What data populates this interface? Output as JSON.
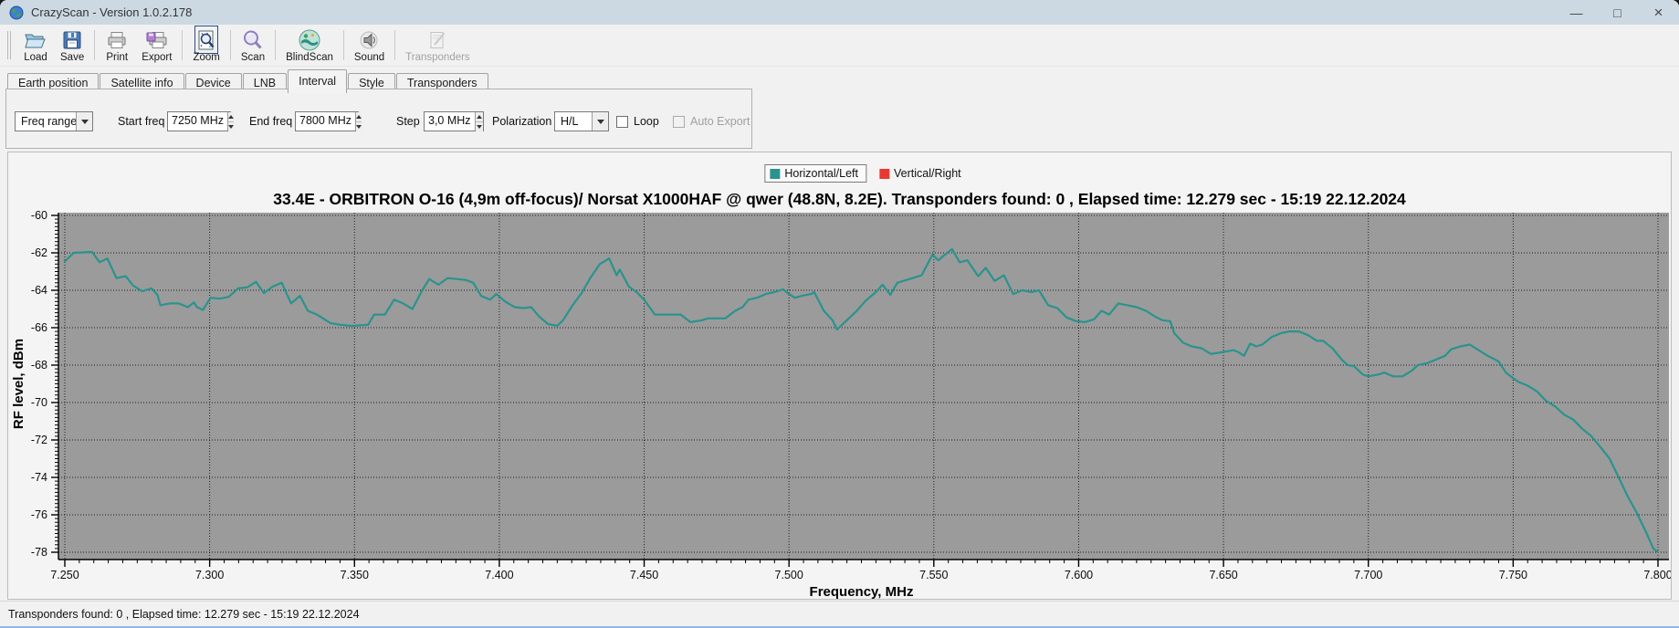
{
  "window": {
    "title": "CrazyScan - Version 1.0.2.178",
    "controls": {
      "minimize": "—",
      "maximize": "□",
      "close": "×"
    }
  },
  "toolbar": {
    "buttons": [
      {
        "label": "Load",
        "icon": "open-folder-icon",
        "enabled": true
      },
      {
        "label": "Save",
        "icon": "floppy-disk-icon",
        "enabled": true
      },
      {
        "label": "Print",
        "icon": "printer-icon",
        "enabled": true
      },
      {
        "label": "Export",
        "icon": "export-printer-icon",
        "enabled": true
      },
      {
        "label": "Zoom",
        "icon": "zoom-document-icon",
        "enabled": true
      },
      {
        "label": "Scan",
        "icon": "magnifier-icon",
        "enabled": true
      },
      {
        "label": "BlindScan",
        "icon": "blindscan-globe-icon",
        "enabled": true
      },
      {
        "label": "Sound",
        "icon": "speaker-icon",
        "enabled": true
      },
      {
        "label": "Transponders",
        "icon": "transponder-list-icon",
        "enabled": false
      }
    ]
  },
  "tabs": {
    "items": [
      {
        "label": "Earth position"
      },
      {
        "label": "Satellite info"
      },
      {
        "label": "Device"
      },
      {
        "label": "LNB"
      },
      {
        "label": "Interval",
        "active": true
      },
      {
        "label": "Style"
      },
      {
        "label": "Transponders"
      }
    ]
  },
  "interval_panel": {
    "freq_range": {
      "value": "Freq range"
    },
    "start_freq": {
      "label": "Start freq",
      "value": "7250 MHz"
    },
    "end_freq": {
      "label": "End freq",
      "value": "7800 MHz"
    },
    "step": {
      "label": "Step",
      "value": "3,0 MHz"
    },
    "polarization": {
      "label": "Polarization",
      "value": "H/L"
    },
    "loop": {
      "label": "Loop",
      "checked": false
    },
    "auto_export": {
      "label": "Auto Export",
      "checked": false,
      "enabled": false
    }
  },
  "statusbar": {
    "text": "Transponders found: 0 , Elapsed time: 12.279 sec - 15:19 22.12.2024"
  },
  "chart_data": {
    "type": "line",
    "title": "33.4E - ORBITRON O-16 (4,9m off-focus)/ Norsat X1000HAF @ qwer (48.8N, 8.2E). Transponders found: 0 , Elapsed time: 12.279 sec - 15:19 22.12.2024",
    "xlabel": "Frequency, MHz",
    "ylabel": "RF level, dBm",
    "xlim": [
      7.25,
      7.8
    ],
    "ylim": [
      -78,
      -60
    ],
    "grid": true,
    "plot_bg": "#9b9b9b",
    "x_minor_step": 0.005,
    "y_minor_step": 0.2,
    "x_ticks": [
      {
        "v": 7.25,
        "label": "7.250"
      },
      {
        "v": 7.3,
        "label": "7.300"
      },
      {
        "v": 7.35,
        "label": "7.350"
      },
      {
        "v": 7.4,
        "label": "7.400"
      },
      {
        "v": 7.45,
        "label": "7.450"
      },
      {
        "v": 7.5,
        "label": "7.500"
      },
      {
        "v": 7.55,
        "label": "7.550"
      },
      {
        "v": 7.6,
        "label": "7.600"
      },
      {
        "v": 7.65,
        "label": "7.650"
      },
      {
        "v": 7.7,
        "label": "7.700"
      },
      {
        "v": 7.75,
        "label": "7.750"
      },
      {
        "v": 7.8,
        "label": "7.800"
      }
    ],
    "y_ticks": [
      {
        "v": -60,
        "label": "-60"
      },
      {
        "v": -62,
        "label": "-62"
      },
      {
        "v": -64,
        "label": "-64"
      },
      {
        "v": -66,
        "label": "-66"
      },
      {
        "v": -68,
        "label": "-68"
      },
      {
        "v": -70,
        "label": "-70"
      },
      {
        "v": -72,
        "label": "-72"
      },
      {
        "v": -74,
        "label": "-74"
      },
      {
        "v": -76,
        "label": "-76"
      },
      {
        "v": -78,
        "label": "-78"
      }
    ],
    "legend": [
      {
        "name": "Horizontal/Left",
        "color": "#2a938d",
        "selected": true
      },
      {
        "name": "Vertical/Right",
        "color": "#e8382f",
        "selected": false
      }
    ],
    "legend_position": "top-center",
    "series": [
      {
        "name": "Horizontal/Left",
        "color": "#2a938d",
        "points": [
          [
            7.25,
            -62.45
          ],
          [
            7.2531,
            -62.0
          ],
          [
            7.2594,
            -61.95
          ],
          [
            7.262,
            -62.5
          ],
          [
            7.2647,
            -62.3
          ],
          [
            7.2678,
            -63.35
          ],
          [
            7.271,
            -63.25
          ],
          [
            7.2736,
            -63.75
          ],
          [
            7.2767,
            -64.05
          ],
          [
            7.2799,
            -63.9
          ],
          [
            7.282,
            -64.25
          ],
          [
            7.283,
            -64.8
          ],
          [
            7.2862,
            -64.7
          ],
          [
            7.2893,
            -64.7
          ],
          [
            7.2925,
            -64.9
          ],
          [
            7.2946,
            -64.65
          ],
          [
            7.2956,
            -64.9
          ],
          [
            7.2977,
            -65.05
          ],
          [
            7.3003,
            -64.4
          ],
          [
            7.3035,
            -64.45
          ],
          [
            7.3066,
            -64.35
          ],
          [
            7.3098,
            -63.9
          ],
          [
            7.3129,
            -63.85
          ],
          [
            7.316,
            -63.55
          ],
          [
            7.3187,
            -64.15
          ],
          [
            7.3218,
            -63.8
          ],
          [
            7.3249,
            -63.6
          ],
          [
            7.3281,
            -64.7
          ],
          [
            7.3312,
            -64.3
          ],
          [
            7.3339,
            -65.1
          ],
          [
            7.337,
            -65.3
          ],
          [
            7.3417,
            -65.75
          ],
          [
            7.3453,
            -65.85
          ],
          [
            7.349,
            -65.9
          ],
          [
            7.3547,
            -65.85
          ],
          [
            7.3568,
            -65.3
          ],
          [
            7.3605,
            -65.3
          ],
          [
            7.3637,
            -64.5
          ],
          [
            7.3668,
            -64.7
          ],
          [
            7.37,
            -65.0
          ],
          [
            7.3732,
            -64.05
          ],
          [
            7.3758,
            -63.4
          ],
          [
            7.379,
            -63.7
          ],
          [
            7.3821,
            -63.35
          ],
          [
            7.3853,
            -63.4
          ],
          [
            7.3884,
            -63.45
          ],
          [
            7.391,
            -63.6
          ],
          [
            7.3937,
            -64.3
          ],
          [
            7.3968,
            -64.5
          ],
          [
            7.399,
            -64.2
          ],
          [
            7.402,
            -64.6
          ],
          [
            7.4053,
            -64.9
          ],
          [
            7.4084,
            -64.95
          ],
          [
            7.411,
            -64.9
          ],
          [
            7.4137,
            -65.4
          ],
          [
            7.4168,
            -65.8
          ],
          [
            7.42,
            -65.9
          ],
          [
            7.422,
            -65.6
          ],
          [
            7.4253,
            -64.8
          ],
          [
            7.4284,
            -64.15
          ],
          [
            7.4316,
            -63.3
          ],
          [
            7.4347,
            -62.6
          ],
          [
            7.4379,
            -62.3
          ],
          [
            7.4405,
            -63.2
          ],
          [
            7.4416,
            -62.9
          ],
          [
            7.4447,
            -63.8
          ],
          [
            7.4474,
            -64.1
          ],
          [
            7.45,
            -64.5
          ],
          [
            7.4537,
            -65.3
          ],
          [
            7.457,
            -65.3
          ],
          [
            7.4626,
            -65.3
          ],
          [
            7.466,
            -65.7
          ],
          [
            7.47,
            -65.6
          ],
          [
            7.472,
            -65.5
          ],
          [
            7.478,
            -65.5
          ],
          [
            7.4814,
            -65.1
          ],
          [
            7.484,
            -64.9
          ],
          [
            7.486,
            -64.5
          ],
          [
            7.489,
            -64.4
          ],
          [
            7.492,
            -64.2
          ],
          [
            7.495,
            -64.1
          ],
          [
            7.498,
            -63.95
          ],
          [
            7.5,
            -64.2
          ],
          [
            7.502,
            -64.4
          ],
          [
            7.5045,
            -64.3
          ],
          [
            7.5077,
            -64.2
          ],
          [
            7.5087,
            -64.1
          ],
          [
            7.512,
            -65.1
          ],
          [
            7.515,
            -65.6
          ],
          [
            7.5166,
            -66.1
          ],
          [
            7.52,
            -65.6
          ],
          [
            7.5234,
            -65.1
          ],
          [
            7.5265,
            -64.55
          ],
          [
            7.53,
            -64.1
          ],
          [
            7.5323,
            -63.7
          ],
          [
            7.535,
            -64.25
          ],
          [
            7.5374,
            -63.6
          ],
          [
            7.5416,
            -63.4
          ],
          [
            7.5458,
            -63.2
          ],
          [
            7.5495,
            -62.1
          ],
          [
            7.5516,
            -62.4
          ],
          [
            7.553,
            -62.2
          ],
          [
            7.5563,
            -61.8
          ],
          [
            7.5589,
            -62.5
          ],
          [
            7.5616,
            -62.4
          ],
          [
            7.5653,
            -63.25
          ],
          [
            7.5679,
            -62.8
          ],
          [
            7.571,
            -63.5
          ],
          [
            7.5742,
            -63.2
          ],
          [
            7.5774,
            -64.2
          ],
          [
            7.5805,
            -64.0
          ],
          [
            7.5837,
            -64.1
          ],
          [
            7.5863,
            -64.0
          ],
          [
            7.5895,
            -64.8
          ],
          [
            7.5926,
            -64.95
          ],
          [
            7.5958,
            -65.45
          ],
          [
            7.599,
            -65.65
          ],
          [
            7.6021,
            -65.7
          ],
          [
            7.6053,
            -65.55
          ],
          [
            7.6079,
            -65.1
          ],
          [
            7.6105,
            -65.3
          ],
          [
            7.6137,
            -64.7
          ],
          [
            7.6168,
            -64.8
          ],
          [
            7.62,
            -64.9
          ],
          [
            7.6232,
            -65.1
          ],
          [
            7.6263,
            -65.4
          ],
          [
            7.6289,
            -65.6
          ],
          [
            7.6316,
            -65.65
          ],
          [
            7.633,
            -66.3
          ],
          [
            7.636,
            -66.8
          ],
          [
            7.639,
            -67.0
          ],
          [
            7.6424,
            -67.1
          ],
          [
            7.6456,
            -67.4
          ],
          [
            7.65,
            -67.3
          ],
          [
            7.6535,
            -67.2
          ],
          [
            7.655,
            -67.3
          ],
          [
            7.6571,
            -67.5
          ],
          [
            7.6592,
            -66.85
          ],
          [
            7.6613,
            -67.0
          ],
          [
            7.6634,
            -66.9
          ],
          [
            7.6666,
            -66.5
          ],
          [
            7.6697,
            -66.3
          ],
          [
            7.6729,
            -66.2
          ],
          [
            7.676,
            -66.2
          ],
          [
            7.6792,
            -66.4
          ],
          [
            7.6823,
            -66.7
          ],
          [
            7.6844,
            -66.7
          ],
          [
            7.6876,
            -67.1
          ],
          [
            7.6908,
            -67.7
          ],
          [
            7.6929,
            -68.0
          ],
          [
            7.695,
            -68.05
          ],
          [
            7.6981,
            -68.5
          ],
          [
            7.7,
            -68.6
          ],
          [
            7.7034,
            -68.5
          ],
          [
            7.7055,
            -68.4
          ],
          [
            7.7086,
            -68.6
          ],
          [
            7.7118,
            -68.6
          ],
          [
            7.715,
            -68.3
          ],
          [
            7.7171,
            -68.0
          ],
          [
            7.7202,
            -67.9
          ],
          [
            7.7234,
            -67.7
          ],
          [
            7.7265,
            -67.5
          ],
          [
            7.7286,
            -67.15
          ],
          [
            7.7318,
            -67.0
          ],
          [
            7.735,
            -66.9
          ],
          [
            7.7381,
            -67.2
          ],
          [
            7.7412,
            -67.5
          ],
          [
            7.7438,
            -67.7
          ],
          [
            7.7449,
            -67.8
          ],
          [
            7.7475,
            -68.4
          ],
          [
            7.75,
            -68.7
          ],
          [
            7.7519,
            -68.9
          ],
          [
            7.755,
            -69.1
          ],
          [
            7.7582,
            -69.4
          ],
          [
            7.7613,
            -69.9
          ],
          [
            7.7644,
            -70.2
          ],
          [
            7.7676,
            -70.65
          ],
          [
            7.7707,
            -70.9
          ],
          [
            7.7738,
            -71.4
          ],
          [
            7.777,
            -71.8
          ],
          [
            7.78,
            -72.35
          ],
          [
            7.7833,
            -73.0
          ],
          [
            7.7864,
            -74.0
          ],
          [
            7.7895,
            -75.0
          ],
          [
            7.7927,
            -75.9
          ],
          [
            7.7958,
            -76.9
          ],
          [
            7.7984,
            -77.8
          ],
          [
            7.8,
            -78.0
          ]
        ]
      },
      {
        "name": "Vertical/Right",
        "color": "#e8382f",
        "points": []
      }
    ]
  }
}
